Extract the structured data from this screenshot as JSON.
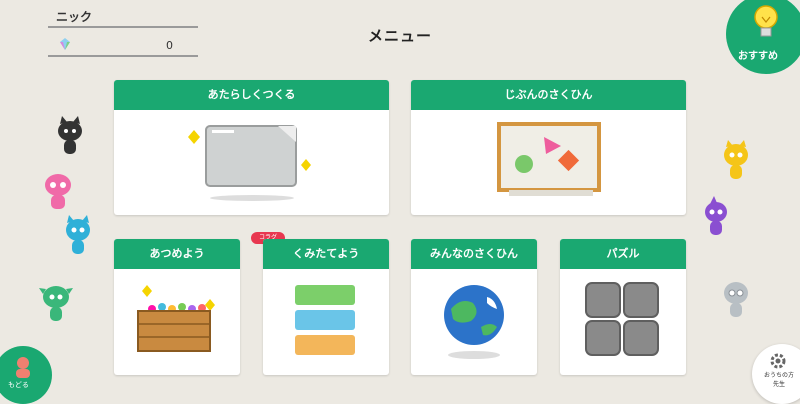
{
  "user": {
    "name": "ニック",
    "gem_count": "0"
  },
  "header": {
    "title": "メニュー"
  },
  "cards": {
    "new_create": "あたらしくつくる",
    "my_works": "じぶんのさくひん",
    "collect": "あつめよう",
    "build": "くみたてよう",
    "everyone_works": "みんなのさくひん",
    "puzzle": "パズル"
  },
  "badge": "コラグ",
  "recommend": {
    "label": "おすすめ"
  },
  "back": {
    "label": "もどる"
  },
  "settings": {
    "label_line1": "おうちの方",
    "label_line2": "先生"
  },
  "colors": {
    "accent": "#1aa871",
    "badge": "#e83850",
    "background": "#ece9e2"
  }
}
